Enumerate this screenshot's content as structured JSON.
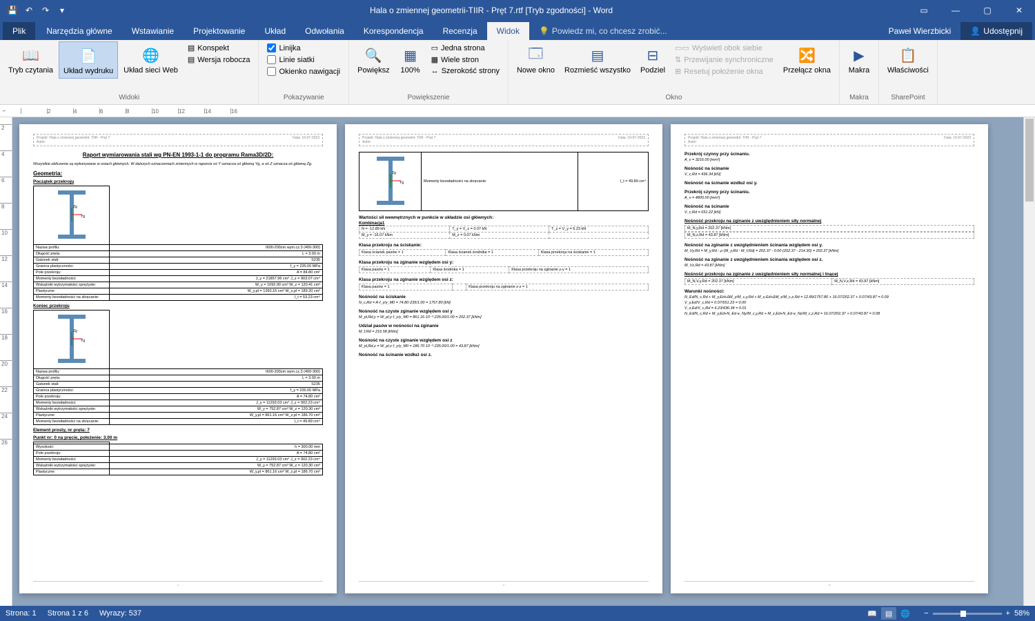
{
  "title": "Hala o zmiennej geometrii-TIIR - Pręt 7.rtf [Tryb zgodności] - Word",
  "user": "Paweł Wierzbicki",
  "share": "Udostępnij",
  "tell_me": "Powiedz mi, co chcesz zrobić...",
  "tabs": {
    "file": "Plik",
    "home": "Narzędzia główne",
    "insert": "Wstawianie",
    "design": "Projektowanie",
    "layout": "Układ",
    "refs": "Odwołania",
    "mail": "Korespondencja",
    "review": "Recenzja",
    "view": "Widok"
  },
  "ribbon": {
    "views": {
      "read": "Tryb czytania",
      "print": "Układ wydruku",
      "web": "Układ sieci Web",
      "outline": "Konspekt",
      "draft": "Wersja robocza",
      "label": "Widoki"
    },
    "show": {
      "ruler": "Linijka",
      "grid": "Linie siatki",
      "nav": "Okienko nawigacji",
      "label": "Pokazywanie"
    },
    "zoom": {
      "zoom": "Powiększ",
      "p100": "100%",
      "one": "Jedna strona",
      "multi": "Wiele stron",
      "width": "Szerokość strony",
      "label": "Powiększenie"
    },
    "window": {
      "new": "Nowe okno",
      "arrange": "Rozmieść wszystko",
      "split": "Podziel",
      "side": "Wyświetl obok siebie",
      "sync": "Przewijanie synchroniczne",
      "reset": "Resetuj położenie okna",
      "switch": "Przełącz okna",
      "label": "Okno"
    },
    "macros": {
      "macros": "Makra",
      "label": "Makra"
    },
    "sp": {
      "props": "Właściwości",
      "label": "SharePoint"
    }
  },
  "status": {
    "page": "Strona: 1",
    "pages": "Strona 1 z 6",
    "words": "Wyrazy: 537",
    "zoom": "58%"
  },
  "doc": {
    "hdr_proj": "Projekt: Hala o zmiennej geometrii- TIIR - Pręt 7",
    "hdr_author": "Autor:",
    "hdr_date": "Data: 10-07-2023",
    "p1": {
      "title": "Raport wymiarowania stali wg PN-EN 1993-1-1 do programu Rama3D/2D:",
      "note": "Wszystkie obliczenia są wykonywane w osiach głównych. W dalszych oznaczeniach zmiennych w raporcie oś Y oznacza oś główną Yg, a oś Z oznacza oś główną Zg.",
      "geo": "Geometria:",
      "start": "Początek przekroju",
      "end": "Koniec przekroju",
      "elem": "Element prosty, nr pręta: 7",
      "point": "Punkt nr: 0 na pręcie, położenie: 3.00 m",
      "rows1": [
        [
          "Nazwa profilu:",
          "I600-200zm wym.cz.3 (400-300)"
        ],
        [
          "Długość pręta:",
          "L = 3.00 m"
        ],
        [
          "Gatunek stali:",
          "S235"
        ],
        [
          "Granica plastyczności:",
          "f_y = 235.00 MPa"
        ],
        [
          "Pole przekroju:",
          "A = 84.80 cm²"
        ],
        [
          "Momenty bezwładności:",
          "J_y = 21857.96 cm⁴   J_z = 903.07 cm⁴"
        ],
        [
          "Wskaźniki wytrzymałości sprężyste:",
          "W_y = 1092.90 cm³   W_z = 120.41 cm³"
        ],
        [
          "Plastyczne:",
          "W_y,pl = 1260.16 cm³   W_z,pl = 189.20 cm³"
        ],
        [
          "Momenty bezwładności na skręcanie:",
          "I_t = 53.23 cm⁴"
        ]
      ],
      "rows2": [
        [
          "Nazwa profilu:",
          "I600-200zm wym.cz.3 (400-300)"
        ],
        [
          "Długość pręta:",
          "L = 3.00 m"
        ],
        [
          "Gatunek stali:",
          "S235"
        ],
        [
          "Granica plastyczności:",
          "f_y = 235.00 MPa"
        ],
        [
          "Pole przekroju:",
          "A = 74.80 cm²"
        ],
        [
          "Momenty bezwładności:",
          "J_y = 11293.03 cm⁴   J_z = 902.23 cm⁴"
        ],
        [
          "Wskaźniki wytrzymałości sprężyste:",
          "W_y = 752.87 cm³   W_z = 120.30 cm³"
        ],
        [
          "Plastyczne:",
          "W_y,pl = 861.16 cm³   W_z,pl = 186.70 cm³"
        ],
        [
          "Momenty bezwładności na skręcanie:",
          "I_t = 49.89 cm⁴"
        ]
      ],
      "rows3": [
        [
          "Wysokość:",
          "h = 300.00 mm"
        ],
        [
          "Pole przekroju:",
          "A = 74.80 cm²"
        ],
        [
          "Momenty bezwładności:",
          "J_y = 11293.03 cm⁴   J_z = 902.23 cm⁴"
        ],
        [
          "Wskaźniki wytrzymałości sprężyste:",
          "W_y = 752.87 cm³   W_z = 120.30 cm³"
        ],
        [
          "Plastyczne:",
          "W_y,pl = 861.16 cm³   W_z,pl = 186.70 cm³"
        ]
      ]
    },
    "p2": {
      "torsion": "Momenty bezwładności na skręcanie:",
      "torsion_v": "I_t = 49.89 cm⁴",
      "internal": "Wartości sił wewnętrznych w punkcie w układzie osi głównych:",
      "comb": "Kombinacja1",
      "forces": [
        [
          "N = -12.89 kN",
          "T_y = V_z = 0.07 kN",
          "T_z = V_y = 6.23 kN"
        ],
        [
          "M_y = -16.07 kNm",
          "M_z = 0.07 kNm",
          ""
        ]
      ],
      "s_comp": "Klasa przekroju na ściskanie:",
      "s_comp_r": [
        "Klasa ścianek pasów = 1",
        "Klasa ścianek środnika = 1",
        "Klasa przekroju na ściskanie = 1"
      ],
      "s_bendy": "Klasa przekroju na zginanie względem osi y:",
      "s_bendy_r": [
        "Klasa pasów = 1",
        "Klasa środnika = 1",
        "Klasa przekroju na zginanie y-y = 1"
      ],
      "s_bendz": "Klasa przekroju na zginanie względem osi z:",
      "s_bendz_r": [
        "Klasa pasów = 1",
        "",
        "Klasa przekroju na zginanie z-z = 1"
      ],
      "h_comp": "Nośność na ściskanie",
      "f_comp": "N_c,Rd = A·f_y/γ_M0 = 74.80·235/1.00 = 1757.80 [kN]",
      "h_my": "Nośność na czyste zginanie względem osi y",
      "f_my": "M_pl,Rd,y = W_pl,y·f_y/γ_M0 = 861.16·10⁻³·235.00/1.00 = 202.37 [kNm]",
      "h_flange": "Udział pasów w nośności na zginanie",
      "f_flange": "M_f,Rd = 216.58 [kNm]",
      "h_mz": "Nośność na czyste zginanie względem osi z",
      "f_mz": "M_pl,Rd,z = W_pl,z·f_y/γ_M0 = 186.70·10⁻³·235.00/1.00 = 43.87 [kNm]",
      "h_shy": "Nośność na ścinanie wzdłuż osi z."
    },
    "p3": {
      "h1": "Przekrój czynny przy ścinaniu.",
      "f1": "A_v = 3216.00 [mm²]",
      "h2": "Nośność na ścinanie",
      "f2": "V_c,Rd = 436.34 [kN]",
      "h3": "Nośność na ścinanie wzdłuż osi y.",
      "h4": "Przekrój czynny przy ścinaniu.",
      "f4": "A_v = 4800.00 [mm²]",
      "h5": "Nośność na ścinanie",
      "f5": "V_c,Rd = 651.22 [kN]",
      "h6": "Nośność przekroju na zginanie z uwzględnieniem siły normalnej",
      "f6a": "M_N,y,Rd = 202.37 [kNm]",
      "f6b": "M_N,z,Rd = 43.87 [kNm]",
      "h7": "Nośność na zginanie z uwzględnieniem ścinania względem osi y.",
      "f7": "M_Vy,Rd = M_y,Rd - ρ·(M_y,Rd - M_f,Rd) = 202.37 - 0.00·(202.37 - 214.30) = 202.37 [kNm]",
      "h8": "Nośność na zginanie z uwzględnieniem ścinania względem osi z.",
      "f8": "M_Vz,Rd = 43.87 [kNm]",
      "h9": "Nośność przekroju na zginanie z uwzględnieniem siły normalnej i tnącej",
      "f9": [
        "M_N,V,y,Rd = 202.37 [kNm]",
        "M_N,V,z,Rd = 43.87 [kNm]"
      ],
      "h10": "Warunki nośności:",
      "w": [
        "N_Ed/N_c,Rd + M_y,Ed+ΔM_y/M_c,y,Rd + M_z,Ed+ΔM_z/M_c,z,Rd = 12.89/1757.80 + 16.07/202.37 + 0.07/43.87 = 0.09",
        "V_y,Ed/V_c,Rd = 0.07/651.23 = 0.00",
        "V_z,Ed/V_c,Rd = 6.23/436.34 = 0.01",
        "N_Ed/N_c,Rd + M_y,Ed+N_Ed·e_Ny/M_c,y,Rd + M_z,Ed+N_Ed·e_Nz/M_c,z,Rd = 16.07/202.37 + 0.07/43.87 = 0.08"
      ]
    },
    "pagenum": [
      "- 1 -",
      "- 2 -",
      "- 3 -"
    ]
  }
}
